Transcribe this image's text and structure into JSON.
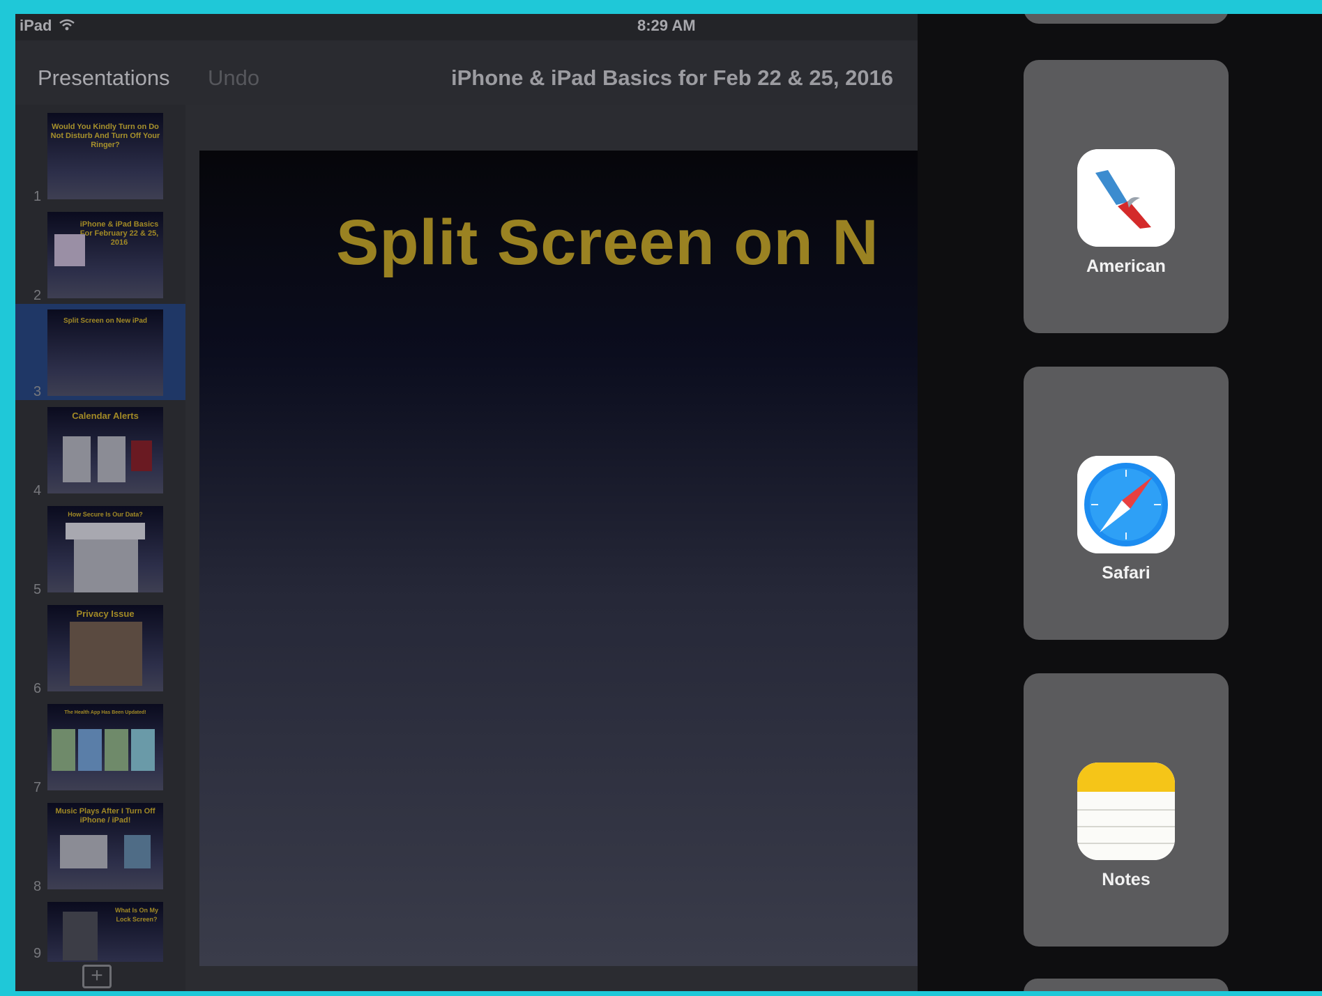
{
  "status_bar": {
    "device": "iPad",
    "time": "8:29 AM"
  },
  "nav_bar": {
    "presentations_label": "Presentations",
    "undo_label": "Undo",
    "document_title": "iPhone & iPad Basics for Feb 22 & 25, 2016"
  },
  "navigator": {
    "selected_index": 3,
    "slides": [
      {
        "number": "1",
        "title": "Would You Kindly Turn on Do Not Disturb And Turn Off Your Ringer?"
      },
      {
        "number": "2",
        "title": "iPhone & iPad Basics For February 22 & 25, 2016"
      },
      {
        "number": "3",
        "title": "Split Screen on New iPad"
      },
      {
        "number": "4",
        "title": "Calendar Alerts"
      },
      {
        "number": "5",
        "title": "How Secure Is Our Data?"
      },
      {
        "number": "6",
        "title": "Privacy Issue"
      },
      {
        "number": "7",
        "title": "The Health App Has Been Updated!"
      },
      {
        "number": "8",
        "title": "Music Plays After I Turn Off iPhone / iPad!"
      },
      {
        "number": "9",
        "title": "What Is On My Lock Screen?"
      }
    ],
    "add_slide_icon": "plus-square-icon"
  },
  "canvas": {
    "slide_title": "Split Screen on N"
  },
  "app_switcher": {
    "apps": [
      {
        "name": "American",
        "icon": "american-airlines-icon"
      },
      {
        "name": "Safari",
        "icon": "safari-compass-icon"
      },
      {
        "name": "Notes",
        "icon": "notes-icon"
      }
    ]
  },
  "colors": {
    "frame": "#1fc8d8",
    "slide_title": "#9a8222",
    "selected_thumb": "#1f3766",
    "card": "#5b5b5d"
  }
}
